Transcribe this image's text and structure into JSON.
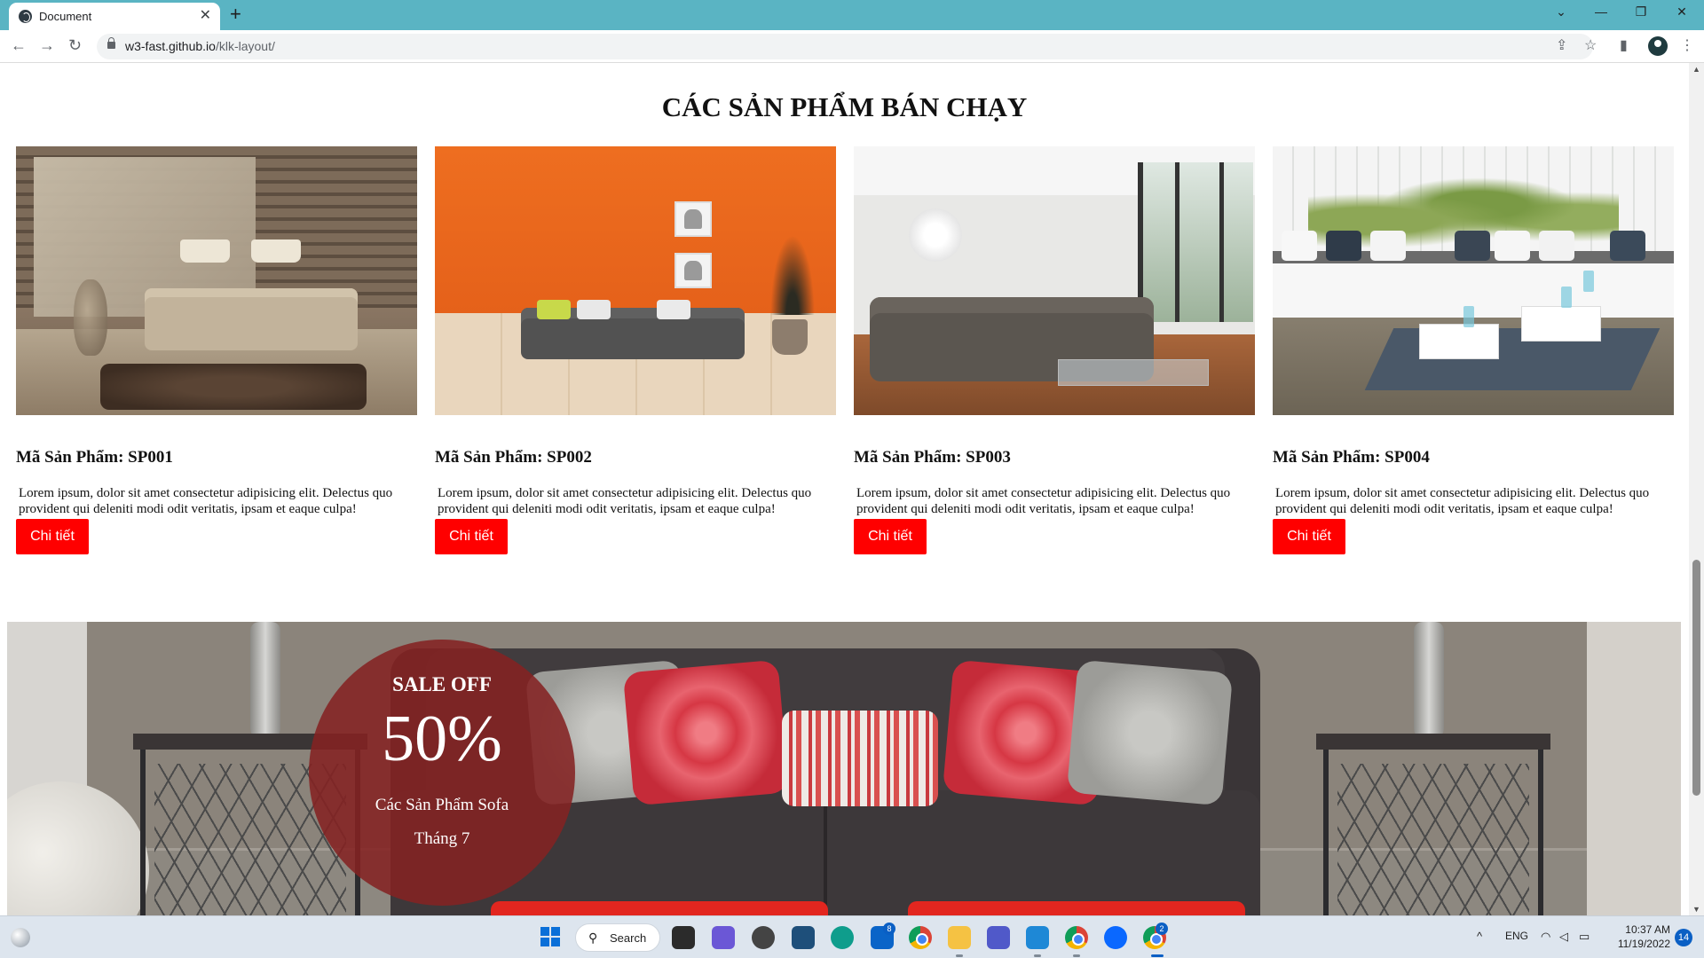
{
  "browser": {
    "tab_title": "Document",
    "new_tab": "+",
    "tab_close": "✕",
    "url_host": "w3-fast.github.io",
    "url_path": "/klk-layout/"
  },
  "page": {
    "section_title": "CÁC SẢN PHẨM BÁN CHẠY",
    "products": [
      {
        "code": "Mã Sản Phẩm: SP001",
        "desc": "Lorem ipsum, dolor sit amet consectetur adipisicing elit. Delectus quo provident qui deleniti modi odit veritatis, ipsam et eaque culpa!",
        "button": "Chi tiết"
      },
      {
        "code": "Mã Sản Phẩm: SP002",
        "desc": "Lorem ipsum, dolor sit amet consectetur adipisicing elit. Delectus quo provident qui deleniti modi odit veritatis, ipsam et eaque culpa!",
        "button": "Chi tiết"
      },
      {
        "code": "Mã Sản Phẩm: SP003",
        "desc": "Lorem ipsum, dolor sit amet consectetur adipisicing elit. Delectus quo provident qui deleniti modi odit veritatis, ipsam et eaque culpa!",
        "button": "Chi tiết"
      },
      {
        "code": "Mã Sản Phẩm: SP004",
        "desc": "Lorem ipsum, dolor sit amet consectetur adipisicing elit. Delectus quo provident qui deleniti modi odit veritatis, ipsam et eaque culpa!",
        "button": "Chi tiết"
      }
    ],
    "banner": {
      "line1": "SALE OFF",
      "line2": "50%",
      "line3": "Các Sản Phẩm Sofa",
      "line4": "Tháng 7"
    }
  },
  "taskbar": {
    "search_label": "Search",
    "mail_badge": "8",
    "chrome_badge": "2",
    "language": "ENG",
    "time": "10:37 AM",
    "date": "11/19/2022",
    "notifications": "14"
  },
  "colors": {
    "tabbar": "#5ab4c3",
    "button": "#ff0000",
    "sale_circle": "#842222"
  }
}
